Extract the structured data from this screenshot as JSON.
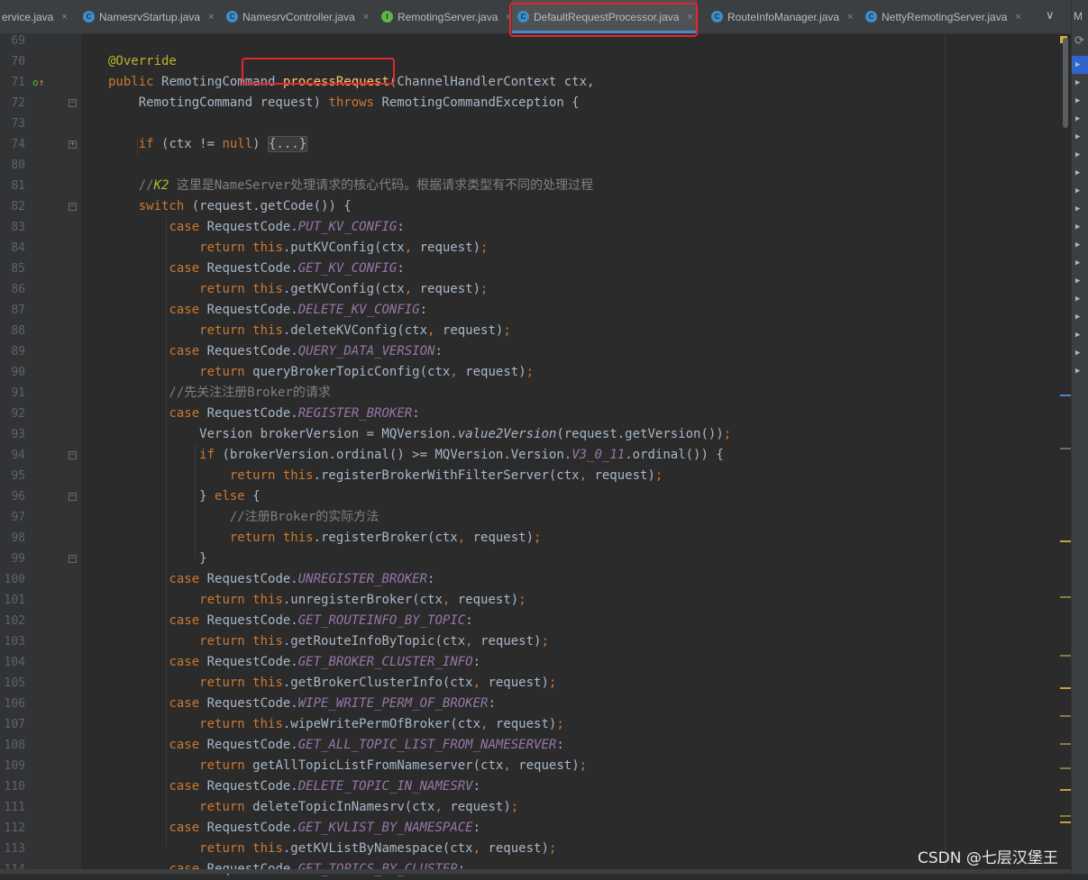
{
  "tabs": [
    {
      "label": "ervice.java",
      "icon": "class-icon",
      "kind": "class"
    },
    {
      "label": "NamesrvStartup.java",
      "icon": "class-icon",
      "kind": "class"
    },
    {
      "label": "NamesrvController.java",
      "icon": "class-icon",
      "kind": "class"
    },
    {
      "label": "RemotingServer.java",
      "icon": "interface-icon",
      "kind": "interface"
    },
    {
      "label": "DefaultRequestProcessor.java",
      "icon": "class-icon",
      "kind": "class",
      "active": true
    },
    {
      "label": "RouteInfoManager.java",
      "icon": "class-icon",
      "kind": "class"
    },
    {
      "label": "NettyRemotingServer.java",
      "icon": "class-icon",
      "kind": "class"
    }
  ],
  "tab_icon_letters": {
    "class": "C",
    "interface": "I"
  },
  "tab_close_glyph": "×",
  "tab_overflow_glyph": "∨",
  "right_panel_label": "M",
  "watermark": "CSDN @七层汉堡王",
  "colors": {
    "keyword": "#cc7832",
    "annotation": "#bbb529",
    "method_declaration": "#ffc66d",
    "constant": "#9876aa",
    "comment": "#808080",
    "default_text": "#a9b7c6",
    "highlight_box": "#e5262d",
    "active_tab_underline": "#4a88c7"
  },
  "lines": [
    {
      "n": "69",
      "tokens": []
    },
    {
      "n": "70",
      "tokens": [
        [
          "ann",
          "@Override"
        ]
      ]
    },
    {
      "n": "71",
      "mark": "override-implements",
      "tokens": [
        [
          "kw",
          "public "
        ],
        [
          "t",
          "RemotingCommand "
        ],
        [
          "fn",
          "processRequest"
        ],
        [
          "t",
          "(ChannelHandlerContext ctx,"
        ]
      ]
    },
    {
      "n": "72",
      "fold": true,
      "tokens": [
        [
          "t",
          "    RemotingCommand request) "
        ],
        [
          "kw",
          "throws "
        ],
        [
          "t",
          "RemotingCommandException {"
        ]
      ]
    },
    {
      "n": "73",
      "tokens": []
    },
    {
      "n": "74",
      "fold": true,
      "tokens": [
        [
          "t",
          "    "
        ],
        [
          "kw",
          "if "
        ],
        [
          "t",
          "(ctx != "
        ],
        [
          "kw",
          "null"
        ],
        [
          "t",
          ") "
        ],
        [
          "fd",
          "{...}"
        ]
      ]
    },
    {
      "n": "80",
      "tokens": []
    },
    {
      "n": "81",
      "tokens": [
        [
          "cm",
          "    //"
        ],
        [
          "todo",
          "K2 "
        ],
        [
          "cm",
          "这里是NameServer处理请求的核心代码。根据请求类型有不同的处理过程"
        ]
      ]
    },
    {
      "n": "82",
      "fold": true,
      "tokens": [
        [
          "t",
          "    "
        ],
        [
          "kw",
          "switch "
        ],
        [
          "t",
          "(request.getCode()) {"
        ]
      ]
    },
    {
      "n": "83",
      "tokens": [
        [
          "t",
          "        "
        ],
        [
          "kw",
          "case "
        ],
        [
          "t",
          "RequestCode."
        ],
        [
          "cst",
          "PUT_KV_CONFIG"
        ],
        [
          "t",
          ":"
        ]
      ]
    },
    {
      "n": "84",
      "tokens": [
        [
          "t",
          "            "
        ],
        [
          "kw",
          "return this"
        ],
        [
          "t",
          ".putKVConfig(ctx"
        ],
        [
          "kw",
          ", "
        ],
        [
          "t",
          "request)"
        ],
        [
          "kw",
          ";"
        ]
      ]
    },
    {
      "n": "85",
      "tokens": [
        [
          "t",
          "        "
        ],
        [
          "kw",
          "case "
        ],
        [
          "t",
          "RequestCode."
        ],
        [
          "cst",
          "GET_KV_CONFIG"
        ],
        [
          "t",
          ":"
        ]
      ]
    },
    {
      "n": "86",
      "tokens": [
        [
          "t",
          "            "
        ],
        [
          "kw",
          "return this"
        ],
        [
          "t",
          ".getKVConfig(ctx"
        ],
        [
          "kw",
          ", "
        ],
        [
          "t",
          "request)"
        ],
        [
          "kw",
          ";"
        ]
      ]
    },
    {
      "n": "87",
      "tokens": [
        [
          "t",
          "        "
        ],
        [
          "kw",
          "case "
        ],
        [
          "t",
          "RequestCode."
        ],
        [
          "cst",
          "DELETE_KV_CONFIG"
        ],
        [
          "t",
          ":"
        ]
      ]
    },
    {
      "n": "88",
      "tokens": [
        [
          "t",
          "            "
        ],
        [
          "kw",
          "return this"
        ],
        [
          "t",
          ".deleteKVConfig(ctx"
        ],
        [
          "kw",
          ", "
        ],
        [
          "t",
          "request)"
        ],
        [
          "kw",
          ";"
        ]
      ]
    },
    {
      "n": "89",
      "tokens": [
        [
          "t",
          "        "
        ],
        [
          "kw",
          "case "
        ],
        [
          "t",
          "RequestCode."
        ],
        [
          "cst",
          "QUERY_DATA_VERSION"
        ],
        [
          "t",
          ":"
        ]
      ]
    },
    {
      "n": "90",
      "tokens": [
        [
          "t",
          "            "
        ],
        [
          "kw",
          "return "
        ],
        [
          "t",
          "queryBrokerTopicConfig(ctx"
        ],
        [
          "kw",
          ", "
        ],
        [
          "t",
          "request)"
        ],
        [
          "kw",
          ";"
        ]
      ]
    },
    {
      "n": "91",
      "tokens": [
        [
          "cm",
          "        //先关注注册Broker的请求"
        ]
      ]
    },
    {
      "n": "92",
      "tokens": [
        [
          "t",
          "        "
        ],
        [
          "kw",
          "case "
        ],
        [
          "t",
          "RequestCode."
        ],
        [
          "cst",
          "REGISTER_BROKER"
        ],
        [
          "t",
          ":"
        ]
      ]
    },
    {
      "n": "93",
      "tokens": [
        [
          "t",
          "            Version brokerVersion = MQVersion."
        ],
        [
          "sm",
          "value2Version"
        ],
        [
          "t",
          "(request.getVersion())"
        ],
        [
          "kw",
          ";"
        ]
      ]
    },
    {
      "n": "94",
      "fold": true,
      "tokens": [
        [
          "t",
          "            "
        ],
        [
          "kw",
          "if "
        ],
        [
          "t",
          "(brokerVersion.ordinal() >= MQVersion.Version."
        ],
        [
          "cst",
          "V3_0_11"
        ],
        [
          "t",
          ".ordinal()) {"
        ]
      ]
    },
    {
      "n": "95",
      "tokens": [
        [
          "t",
          "                "
        ],
        [
          "kw",
          "return this"
        ],
        [
          "t",
          ".registerBrokerWithFilterServer(ctx"
        ],
        [
          "kw",
          ", "
        ],
        [
          "t",
          "request)"
        ],
        [
          "kw",
          ";"
        ]
      ]
    },
    {
      "n": "96",
      "fold": true,
      "tokens": [
        [
          "t",
          "            } "
        ],
        [
          "kw",
          "else "
        ],
        [
          "t",
          "{"
        ]
      ]
    },
    {
      "n": "97",
      "tokens": [
        [
          "cm",
          "                //注册Broker的实际方法"
        ]
      ]
    },
    {
      "n": "98",
      "tokens": [
        [
          "t",
          "                "
        ],
        [
          "kw",
          "return this"
        ],
        [
          "t",
          ".registerBroker(ctx"
        ],
        [
          "kw",
          ", "
        ],
        [
          "t",
          "request)"
        ],
        [
          "kw",
          ";"
        ]
      ]
    },
    {
      "n": "99",
      "fold": true,
      "tokens": [
        [
          "t",
          "            }"
        ]
      ]
    },
    {
      "n": "100",
      "tokens": [
        [
          "t",
          "        "
        ],
        [
          "kw",
          "case "
        ],
        [
          "t",
          "RequestCode."
        ],
        [
          "cst",
          "UNREGISTER_BROKER"
        ],
        [
          "t",
          ":"
        ]
      ]
    },
    {
      "n": "101",
      "tokens": [
        [
          "t",
          "            "
        ],
        [
          "kw",
          "return this"
        ],
        [
          "t",
          ".unregisterBroker(ctx"
        ],
        [
          "kw",
          ", "
        ],
        [
          "t",
          "request)"
        ],
        [
          "kw",
          ";"
        ]
      ]
    },
    {
      "n": "102",
      "tokens": [
        [
          "t",
          "        "
        ],
        [
          "kw",
          "case "
        ],
        [
          "t",
          "RequestCode."
        ],
        [
          "cst",
          "GET_ROUTEINFO_BY_TOPIC"
        ],
        [
          "t",
          ":"
        ]
      ]
    },
    {
      "n": "103",
      "tokens": [
        [
          "t",
          "            "
        ],
        [
          "kw",
          "return this"
        ],
        [
          "t",
          ".getRouteInfoByTopic(ctx"
        ],
        [
          "kw",
          ", "
        ],
        [
          "t",
          "request)"
        ],
        [
          "kw",
          ";"
        ]
      ]
    },
    {
      "n": "104",
      "tokens": [
        [
          "t",
          "        "
        ],
        [
          "kw",
          "case "
        ],
        [
          "t",
          "RequestCode."
        ],
        [
          "cst",
          "GET_BROKER_CLUSTER_INFO"
        ],
        [
          "t",
          ":"
        ]
      ]
    },
    {
      "n": "105",
      "tokens": [
        [
          "t",
          "            "
        ],
        [
          "kw",
          "return this"
        ],
        [
          "t",
          ".getBrokerClusterInfo(ctx"
        ],
        [
          "kw",
          ", "
        ],
        [
          "t",
          "request)"
        ],
        [
          "kw",
          ";"
        ]
      ]
    },
    {
      "n": "106",
      "tokens": [
        [
          "t",
          "        "
        ],
        [
          "kw",
          "case "
        ],
        [
          "t",
          "RequestCode."
        ],
        [
          "cst",
          "WIPE_WRITE_PERM_OF_BROKER"
        ],
        [
          "t",
          ":"
        ]
      ]
    },
    {
      "n": "107",
      "tokens": [
        [
          "t",
          "            "
        ],
        [
          "kw",
          "return this"
        ],
        [
          "t",
          ".wipeWritePermOfBroker(ctx"
        ],
        [
          "kw",
          ", "
        ],
        [
          "t",
          "request)"
        ],
        [
          "kw",
          ";"
        ]
      ]
    },
    {
      "n": "108",
      "tokens": [
        [
          "t",
          "        "
        ],
        [
          "kw",
          "case "
        ],
        [
          "t",
          "RequestCode."
        ],
        [
          "cst",
          "GET_ALL_TOPIC_LIST_FROM_NAMESERVER"
        ],
        [
          "t",
          ":"
        ]
      ]
    },
    {
      "n": "109",
      "tokens": [
        [
          "t",
          "            "
        ],
        [
          "kw",
          "return "
        ],
        [
          "t",
          "getAllTopicListFromNameserver(ctx"
        ],
        [
          "kw",
          ", "
        ],
        [
          "t",
          "request)"
        ],
        [
          "kw",
          ";"
        ]
      ]
    },
    {
      "n": "110",
      "tokens": [
        [
          "t",
          "        "
        ],
        [
          "kw",
          "case "
        ],
        [
          "t",
          "RequestCode."
        ],
        [
          "cst",
          "DELETE_TOPIC_IN_NAMESRV"
        ],
        [
          "t",
          ":"
        ]
      ]
    },
    {
      "n": "111",
      "tokens": [
        [
          "t",
          "            "
        ],
        [
          "kw",
          "return "
        ],
        [
          "t",
          "deleteTopicInNamesrv(ctx"
        ],
        [
          "kw",
          ", "
        ],
        [
          "t",
          "request)"
        ],
        [
          "kw",
          ";"
        ]
      ]
    },
    {
      "n": "112",
      "tokens": [
        [
          "t",
          "        "
        ],
        [
          "kw",
          "case "
        ],
        [
          "t",
          "RequestCode."
        ],
        [
          "cst",
          "GET_KVLIST_BY_NAMESPACE"
        ],
        [
          "t",
          ":"
        ]
      ]
    },
    {
      "n": "113",
      "tokens": [
        [
          "t",
          "            "
        ],
        [
          "kw",
          "return this"
        ],
        [
          "t",
          ".getKVListByNamespace(ctx"
        ],
        [
          "kw",
          ", "
        ],
        [
          "t",
          "request)"
        ],
        [
          "kw",
          ";"
        ]
      ]
    },
    {
      "n": "114",
      "tokens": [
        [
          "t",
          "        "
        ],
        [
          "kw",
          "case "
        ],
        [
          "t",
          "RequestCode."
        ],
        [
          "cst",
          "GET_TOPICS_BY_CLUSTER"
        ],
        [
          "t",
          ":"
        ]
      ]
    }
  ]
}
